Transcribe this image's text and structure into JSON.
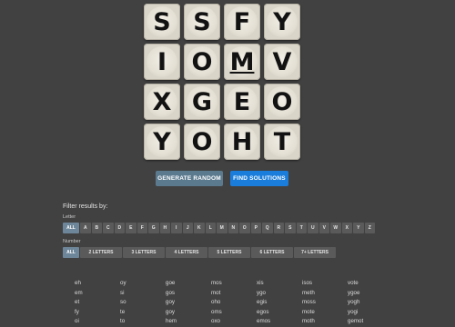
{
  "board": {
    "tiles": [
      {
        "letter": "S",
        "underline": false
      },
      {
        "letter": "S",
        "underline": false
      },
      {
        "letter": "F",
        "underline": false
      },
      {
        "letter": "Y",
        "underline": false
      },
      {
        "letter": "I",
        "underline": false
      },
      {
        "letter": "O",
        "underline": false
      },
      {
        "letter": "M",
        "underline": true
      },
      {
        "letter": "V",
        "underline": false
      },
      {
        "letter": "X",
        "underline": false
      },
      {
        "letter": "G",
        "underline": false
      },
      {
        "letter": "E",
        "underline": false
      },
      {
        "letter": "O",
        "underline": false
      },
      {
        "letter": "Y",
        "underline": false
      },
      {
        "letter": "O",
        "underline": false
      },
      {
        "letter": "H",
        "underline": false
      },
      {
        "letter": "T",
        "underline": false
      }
    ]
  },
  "actions": {
    "generate_label": "GENERATE RANDOM",
    "solve_label": "FIND SOLUTIONS"
  },
  "filters": {
    "heading": "Filter results by:",
    "letter_label": "Letter",
    "letters": [
      "ALL",
      "A",
      "B",
      "C",
      "D",
      "E",
      "F",
      "G",
      "H",
      "I",
      "J",
      "K",
      "L",
      "M",
      "N",
      "O",
      "P",
      "Q",
      "R",
      "S",
      "T",
      "U",
      "V",
      "W",
      "X",
      "Y",
      "Z"
    ],
    "number_label": "Number",
    "numbers": [
      "ALL",
      "2 LETTERS",
      "3 LETTERS",
      "4 LETTERS",
      "5 LETTERS",
      "6 LETTERS",
      "7+ LETTERS"
    ],
    "selected_letter": "ALL",
    "selected_number": "ALL"
  },
  "results": {
    "columns": [
      [
        "eh",
        "em",
        "et",
        "fy",
        "oi"
      ],
      [
        "oy",
        "si",
        "so",
        "te",
        "to"
      ],
      [
        "goe",
        "gos",
        "goy",
        "goy",
        "hem"
      ],
      [
        "mos",
        "mot",
        "oho",
        "oms",
        "oxo"
      ],
      [
        "xis",
        "ygo",
        "egis",
        "egos",
        "emos"
      ],
      [
        "isos",
        "meth",
        "moss",
        "mote",
        "moth"
      ],
      [
        "vote",
        "ygoe",
        "yogh",
        "yogi",
        "gemot"
      ]
    ]
  },
  "colors": {
    "background": "#414141",
    "tile": "#d9d5c9",
    "generate_button": "#5b7a8e",
    "solve_button": "#1a7ddb",
    "pill": "#5a5a5a",
    "pill_selected": "#6e8699"
  }
}
